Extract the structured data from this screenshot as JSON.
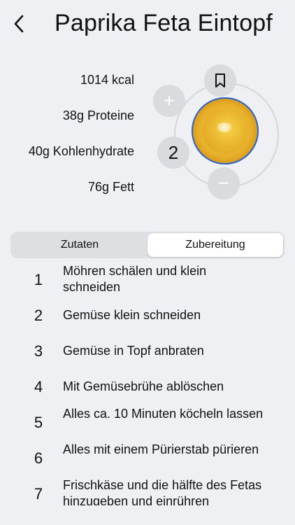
{
  "header": {
    "title": "Paprika Feta Eintopf",
    "back_icon": "chevron-left-icon"
  },
  "nutrition": {
    "kcal": "1014 kcal",
    "protein": "38g Proteine",
    "carbs": "40g Kohlenhydrate",
    "fat": "76g Fett"
  },
  "servings": {
    "count": "2",
    "plus": "+",
    "minus": "−"
  },
  "segmented": {
    "tab_ingredients": "Zutaten",
    "tab_preparation": "Zubereitung",
    "selected": "Zubereitung"
  },
  "steps": [
    {
      "num": "1",
      "text": "Möhren schälen und klein schneiden"
    },
    {
      "num": "2",
      "text": "Gemüse klein schneiden"
    },
    {
      "num": "3",
      "text": "Gemüse in Topf anbraten"
    },
    {
      "num": "4",
      "text": "Mit Gemüsebrühe ablöschen"
    },
    {
      "num": "5",
      "text": "Alles ca. 10 Minuten köcheln lassen"
    },
    {
      "num": "6",
      "text": "Alles mit einem Pürierstab pürieren"
    },
    {
      "num": "7",
      "text": "Frischkäse und die hälfte des Fetas hinzugeben und einrühren"
    }
  ],
  "colors": {
    "background": "#eef0f3",
    "button_gray": "#d9dbdf",
    "dish_blue": "#2a6ae0",
    "dish_yellow": "#eab52e"
  }
}
